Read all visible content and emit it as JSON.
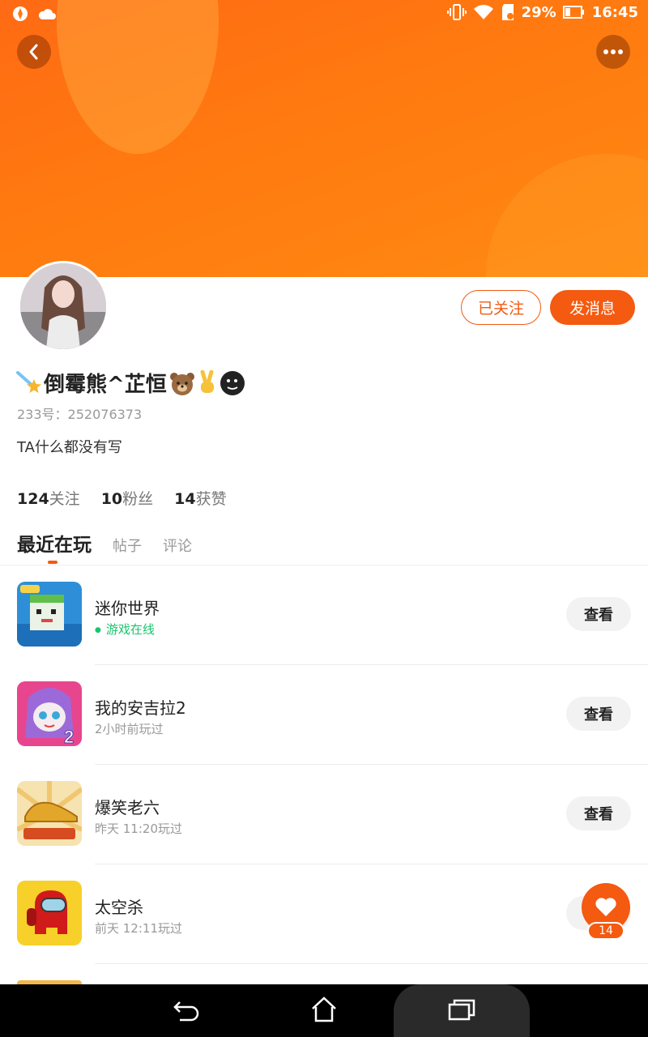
{
  "status_bar": {
    "battery": "29%",
    "time": "16:45"
  },
  "profile": {
    "follow_button": "已关注",
    "message_button": "发消息",
    "nickname": "倒霉熊^芷恒",
    "id_text": "233号：252076373",
    "bio": "TA什么都没有写",
    "stats": [
      {
        "num": "124",
        "label": "关注"
      },
      {
        "num": "10",
        "label": "粉丝"
      },
      {
        "num": "14",
        "label": "获赞"
      }
    ]
  },
  "tabs": [
    "最近在玩",
    "帖子",
    "评论"
  ],
  "games": [
    {
      "title": "迷你世界",
      "subtitle": "游戏在线",
      "button": "查看",
      "icon": "mini-world-icon"
    },
    {
      "title": "我的安吉拉2",
      "subtitle": "2小时前玩过",
      "button": "查看",
      "icon": "angela-icon"
    },
    {
      "title": "爆笑老六",
      "subtitle": "昨天 11:20玩过",
      "button": "查看",
      "icon": "golden-shoe-icon"
    },
    {
      "title": "太空杀",
      "subtitle": "前天 12:11玩过",
      "button": "查看",
      "icon": "crewmate-icon"
    }
  ],
  "like_fab": {
    "count": "14"
  },
  "icons": {
    "back": "chevron-left-icon",
    "more": "more-dots-icon",
    "like": "heart-icon"
  },
  "colors": {
    "accent": "#f45a10",
    "header": "#ff7a10",
    "online": "#17c66d"
  }
}
